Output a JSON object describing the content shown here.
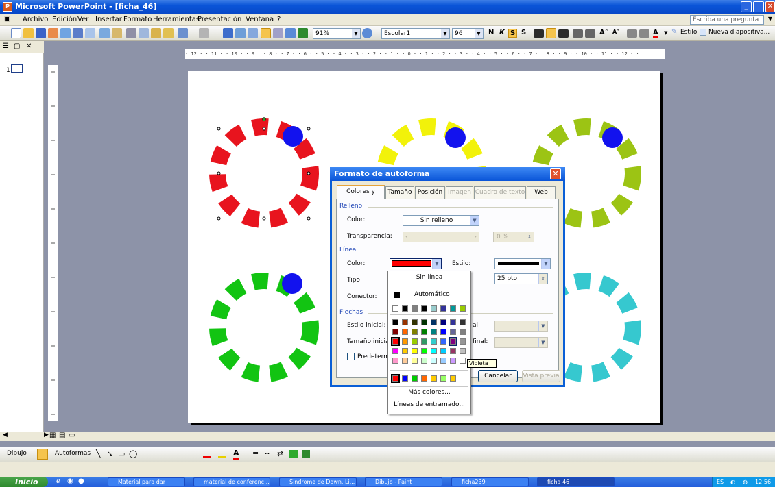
{
  "window": {
    "title": "Microsoft PowerPoint - [ficha_46]",
    "app_icon": "powerpoint-icon"
  },
  "menu": {
    "items": [
      "Archivo",
      "Edición",
      "Ver",
      "Insertar",
      "Formato",
      "Herramientas",
      "Presentación",
      "Ventana",
      "?"
    ],
    "help_placeholder": "Escriba una pregunta"
  },
  "toolbar": {
    "zoom": "91%",
    "font": "Escolar1",
    "font_size": "96",
    "bold": "N",
    "italic": "K",
    "underline": "S",
    "shadow": "S",
    "style_label": "Estilo",
    "new_slide_label": "Nueva diapositiva..."
  },
  "ruler": {
    "horizontal_text": "· 12 · · 11 · · 10 · · 9 · · 8 · · 7 · · 6 · · 5 · · 4 · · 3 · · 2 · · 1 · · 0 · · 1 · · 2 · · 3 · · 4 · · 5 · · 6 · · 7 · · 8 · · 9 · · 10 · · 11 · · 12 · ·"
  },
  "slides_pane": {
    "thumb_number": "1"
  },
  "slide": {
    "colors": {
      "red": "#e8141e",
      "yellow": "#f2f20a",
      "olive": "#9cc414",
      "green": "#12c412",
      "cyan": "#36c8cf",
      "ball": "#1212ee"
    }
  },
  "dialog": {
    "title": "Formato de autoforma",
    "tabs": [
      "Colores y líneas",
      "Tamaño",
      "Posición",
      "Imagen",
      "Cuadro de texto",
      "Web"
    ],
    "fill_section": "Relleno",
    "fill_color_label": "Color:",
    "fill_color_value": "Sin relleno",
    "transparency_label": "Transparencia:",
    "transparency_value": "0 %",
    "line_section": "Línea",
    "line_color_label": "Color:",
    "line_color": "#ff0000",
    "style_label": "Estilo:",
    "type_label": "Tipo:",
    "connector_label": "Conector:",
    "weight_value": "25 pto",
    "arrows_section": "Flechas",
    "start_style_label": "Estilo inicial:",
    "start_size_label": "Tamaño inicial:",
    "end_style_partial": "al:",
    "end_size_partial": "final:",
    "default_checkbox_label": "Predetermina",
    "cancel_label": "Cancelar",
    "preview_label": "Vista previa"
  },
  "color_popup": {
    "no_line": "Sin línea",
    "automatic": "Automático",
    "more_colors": "Más colores...",
    "pattern_lines": "Líneas de entramado...",
    "scheme_row": [
      "#ffffff",
      "#000000",
      "#808080",
      "#000000",
      "#99cccc",
      "#333399",
      "#009999",
      "#99cc00"
    ],
    "standard_rows": [
      [
        "#000000",
        "#993300",
        "#333300",
        "#003300",
        "#003366",
        "#000080",
        "#333399",
        "#333333"
      ],
      [
        "#800000",
        "#ff6600",
        "#808000",
        "#008000",
        "#008080",
        "#0000ff",
        "#666699",
        "#808080"
      ],
      [
        "#ff0000",
        "#ff9900",
        "#99cc00",
        "#339966",
        "#33cccc",
        "#3366ff",
        "#800080",
        "#969696"
      ],
      [
        "#ff00ff",
        "#ffcc00",
        "#ffff00",
        "#00ff00",
        "#00ffff",
        "#00ccff",
        "#993366",
        "#c0c0c0"
      ],
      [
        "#ff99cc",
        "#ffcc99",
        "#ffff99",
        "#ccffcc",
        "#ccffff",
        "#99ccff",
        "#cc99ff",
        "#ffffff"
      ]
    ],
    "recent_row": [
      "#ff0000",
      "#0000ff",
      "#00cc00",
      "#ff6600",
      "#ffcc00",
      "#99ff66",
      "#ffcc00"
    ],
    "tooltip": "Violeta"
  },
  "drawing_toolbar": {
    "draw_label": "Dibujo",
    "autoshapes_label": "Autoformas"
  },
  "taskbar": {
    "start_label": "Inicio",
    "tasks": [
      "Material para dar",
      "material de conferenc...",
      "Síndrome de Down. Li...",
      "Dibujo - Paint",
      "ficha239",
      "ficha 46"
    ],
    "lang": "ES",
    "clock": "12:56"
  }
}
